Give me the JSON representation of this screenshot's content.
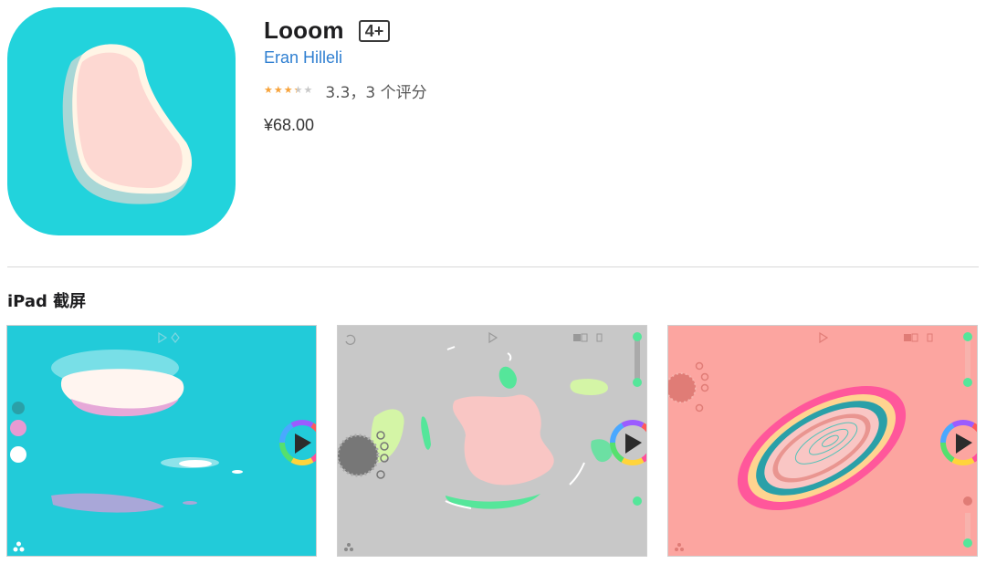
{
  "app": {
    "title": "Looom",
    "age_rating": "4+",
    "developer": "Eran Hilleli",
    "rating": 3.3,
    "rating_text": "3.3，3 个评分",
    "price": "¥68.00",
    "icon_colors": {
      "background": "#22d3dc",
      "blob": "#fdd8d2",
      "shadow": "#a8d7d6"
    }
  },
  "stars": {
    "filled_color": "#f7a33b",
    "empty_color": "#c8c8c8"
  },
  "screenshots": {
    "section_title": "iPad 截屏",
    "items": [
      {
        "name": "screenshot-1",
        "background": "#22cbd9"
      },
      {
        "name": "screenshot-2",
        "background": "#c8c8c8"
      },
      {
        "name": "screenshot-3",
        "background": "#fca5a0"
      }
    ]
  }
}
